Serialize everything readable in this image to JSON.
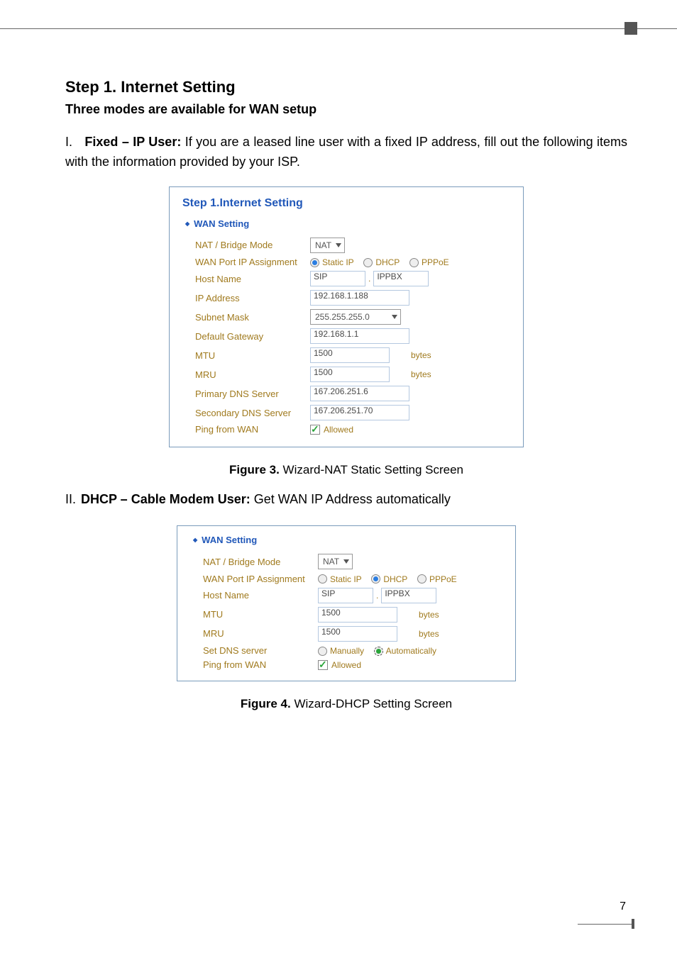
{
  "page": {
    "step_title": "Step 1. Internet Setting",
    "subhead": "Three modes are available for WAN setup",
    "item1_num": "I.",
    "item1_label": "Fixed – IP User:",
    "item1_text": " If you are a leased line user with a fixed IP address, fill out the following items with the information provided by your ISP.",
    "fig3": "Figure 3.",
    "fig3_text": "  Wizard-NAT Static Setting Screen",
    "item2_num": "II.",
    "item2_label": "DHCP – Cable Modem User:",
    "item2_text": " Get WAN IP Address automatically",
    "fig4": "Figure 4.",
    "fig4_text": "  Wizard-DHCP Setting Screen",
    "pagenum": "7"
  },
  "panel1": {
    "title": "Step  1.Internet Setting",
    "sub": "WAN Setting",
    "labels": {
      "nat": "NAT / Bridge Mode",
      "wanport": "WAN Port IP Assignment",
      "host": "Host Name",
      "ip": "IP Address",
      "subnet": "Subnet Mask",
      "gw": "Default Gateway",
      "mtu": "MTU",
      "mru": "MRU",
      "dns1": "Primary DNS Server",
      "dns2": "Secondary DNS Server",
      "ping": "Ping from WAN"
    },
    "values": {
      "nat_sel": "NAT",
      "radio_static": "Static IP",
      "radio_dhcp": "DHCP",
      "radio_pppoe": "PPPoE",
      "host1": "SIP",
      "host2": "IPPBX",
      "ip": "192.168.1.188",
      "subnet_sel": "255.255.255.0",
      "gw": "192.168.1.1",
      "mtu": "1500",
      "mru": "1500",
      "bytes": "bytes",
      "dns1": "167.206.251.6",
      "dns2": "167.206.251.70",
      "allowed": "Allowed"
    }
  },
  "panel2": {
    "sub": "WAN Setting",
    "labels": {
      "nat": "NAT / Bridge Mode",
      "wanport": "WAN Port IP Assignment",
      "host": "Host Name",
      "mtu": "MTU",
      "mru": "MRU",
      "dns": "Set DNS server",
      "ping": "Ping from WAN"
    },
    "values": {
      "nat_sel": "NAT",
      "radio_static": "Static IP",
      "radio_dhcp": "DHCP",
      "radio_pppoe": "PPPoE",
      "host1": "SIP",
      "host2": "IPPBX",
      "mtu": "1500",
      "mru": "1500",
      "bytes": "bytes",
      "manual": "Manually",
      "auto": "Automatically",
      "allowed": "Allowed"
    }
  }
}
